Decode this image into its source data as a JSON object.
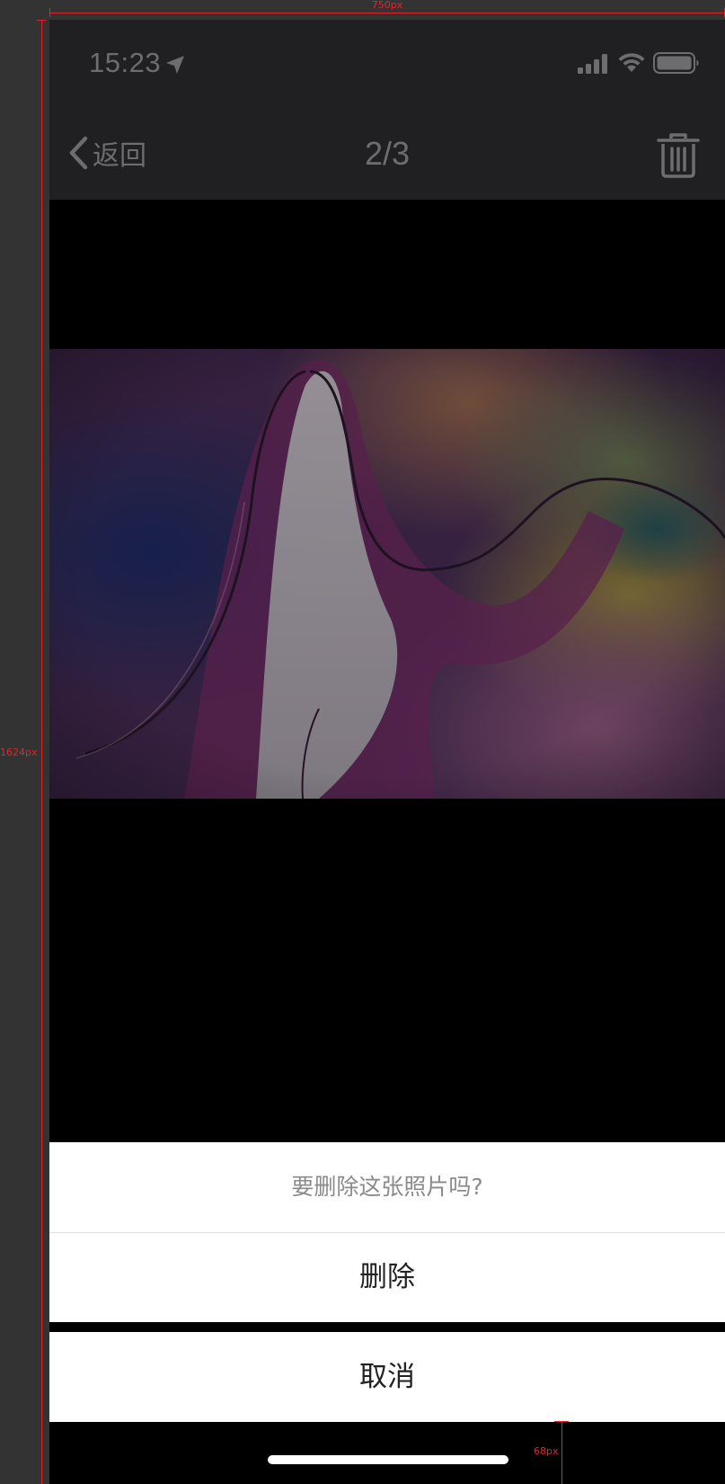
{
  "annotations": {
    "width_label": "750px",
    "height_label": "1624px",
    "bottom_label": "68px"
  },
  "status_bar": {
    "time": "15:23"
  },
  "nav": {
    "back_label": "返回",
    "title": "2/3"
  },
  "action_sheet": {
    "title": "要删除这张照片吗?",
    "delete_label": "删除",
    "cancel_label": "取消"
  },
  "icons": {
    "location": "location-arrow-icon",
    "signal": "cellular-signal-icon",
    "wifi": "wifi-icon",
    "battery": "battery-icon",
    "back": "chevron-left-icon",
    "trash": "trash-icon"
  },
  "colors": {
    "nav_background": "#202022",
    "nav_text": "#6d6d70",
    "sheet_background": "#ffffff",
    "sheet_title_text": "#8a8a8a",
    "sheet_action_text": "#222222",
    "annotation": "#e0252a"
  }
}
